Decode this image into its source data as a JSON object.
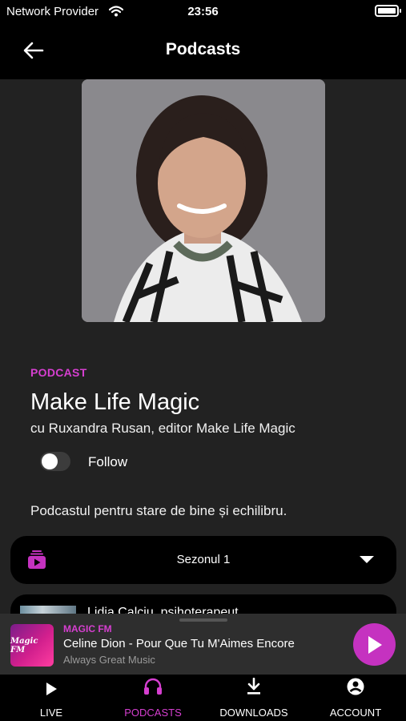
{
  "status_bar": {
    "carrier": "Network Provider",
    "time": "23:56"
  },
  "header": {
    "title": "Podcasts"
  },
  "podcast": {
    "tag": "PODCAST",
    "title": "Make Life Magic",
    "subtitle": "cu Ruxandra Rusan, editor Make Life Magic",
    "follow_label": "Follow",
    "following": false,
    "description": "Podcastul pentru stare de bine și echilibru."
  },
  "season_select": {
    "selected": "Sezonul 1"
  },
  "episodes": [
    {
      "title": "Lidia Calciu, psihoterapeut"
    }
  ],
  "mini_player": {
    "logo_text": "Magic FM",
    "station": "MAGIC FM",
    "song": "Celine Dion - Pour Que Tu M'Aimes Encore",
    "slogan": "Always Great Music"
  },
  "tabs": [
    {
      "label": "LIVE",
      "icon": "play-icon",
      "active": false
    },
    {
      "label": "PODCASTS",
      "icon": "headphones-icon",
      "active": true
    },
    {
      "label": "DOWNLOADS",
      "icon": "download-icon",
      "active": false
    },
    {
      "label": "ACCOUNT",
      "icon": "account-icon",
      "active": false
    }
  ],
  "colors": {
    "accent": "#d63fd0",
    "background": "#222222",
    "bar": "#000000",
    "player": "#2e2e2e"
  }
}
